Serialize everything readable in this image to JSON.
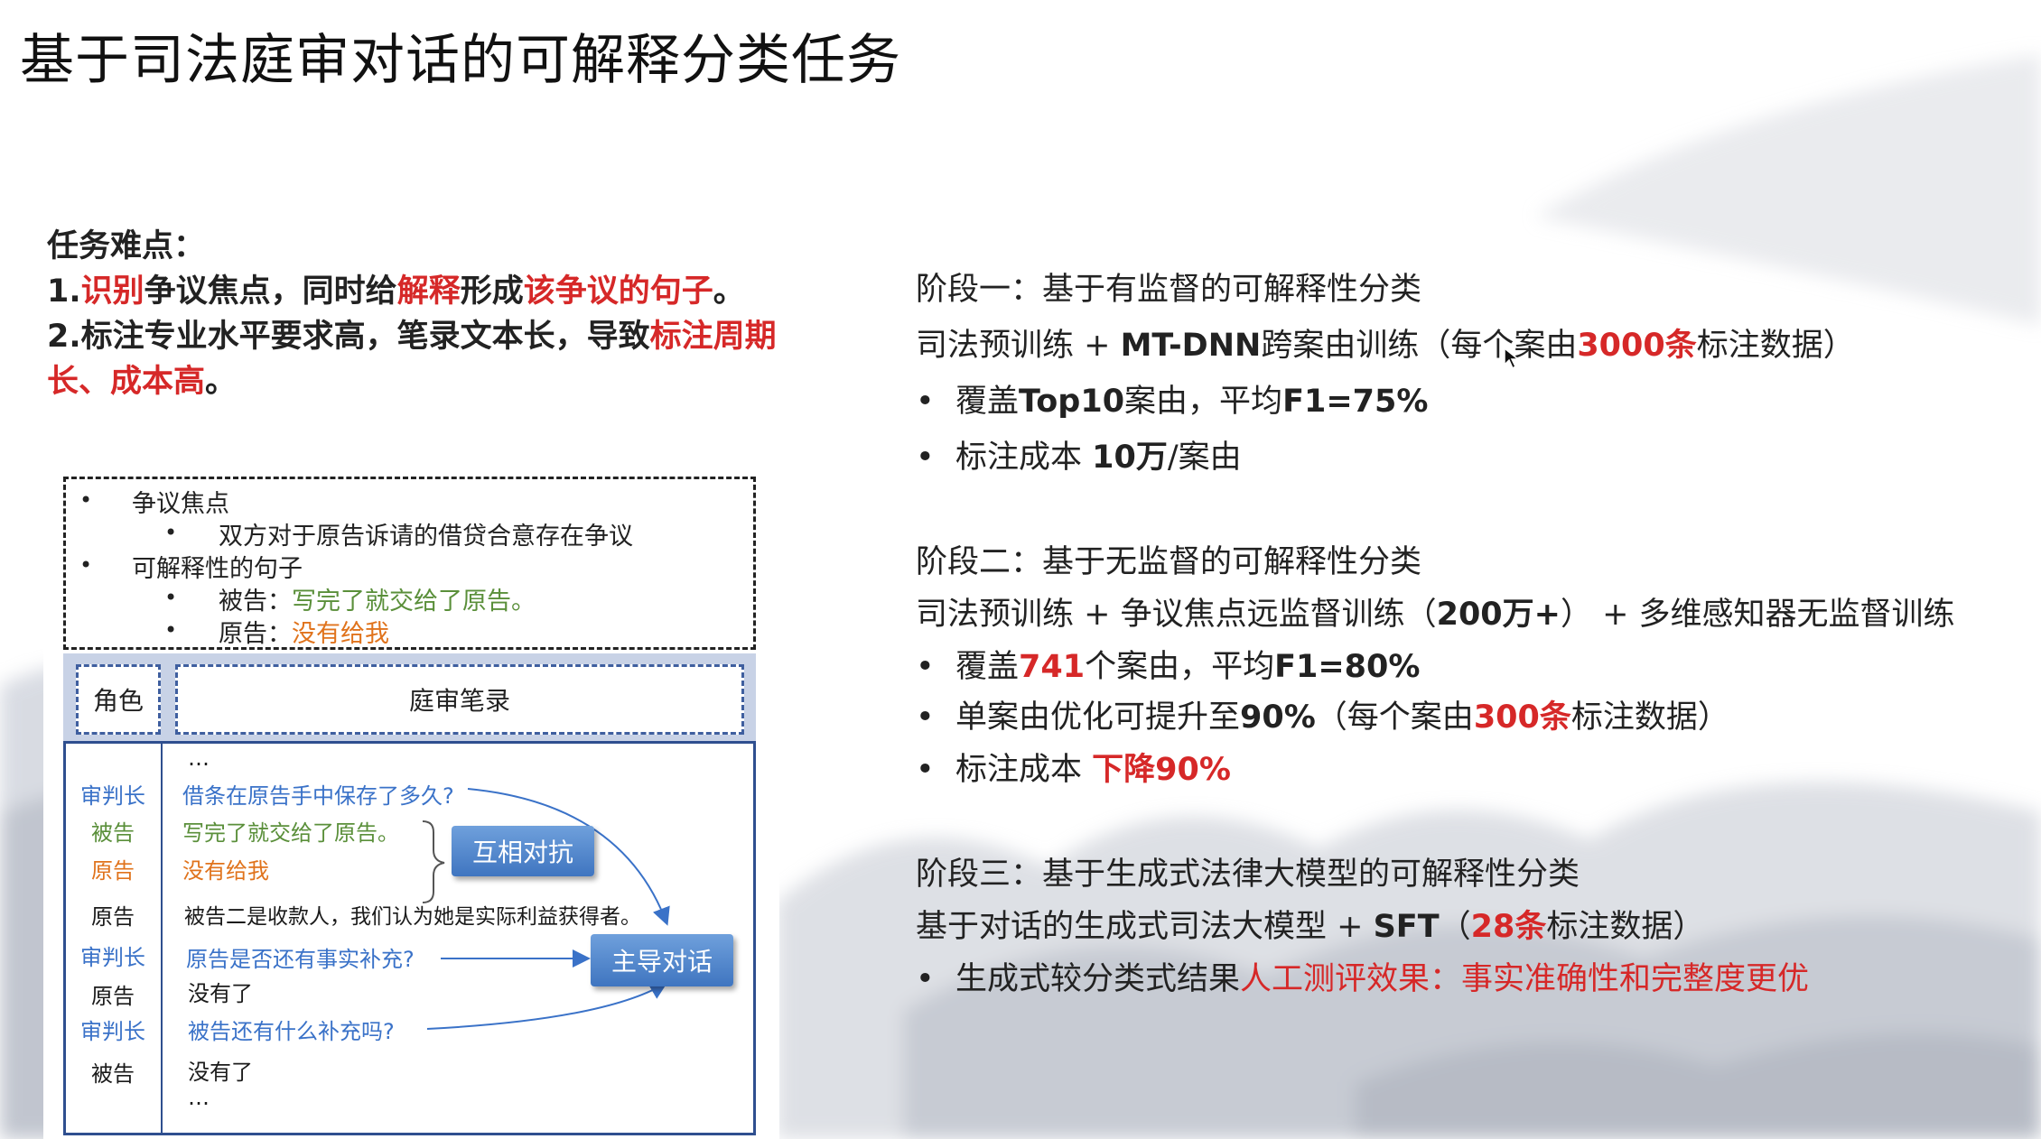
{
  "title": "基于司法庭审对话的可解释分类任务",
  "difficulty": {
    "heading": "任务难点：",
    "line1": {
      "p1": "1.",
      "p2": "识别",
      "p3": "争议焦点，同时给",
      "p4": "解释",
      "p5": "形成",
      "p6": "该争议的句子",
      "p7": "。"
    },
    "line2": {
      "p1": "2.标注专业水平要求高，笔录文本长，导致",
      "p2": "标注周期长、成本高",
      "p3": "。"
    }
  },
  "figure": {
    "bullets": {
      "focus_label": "争议焦点",
      "focus_detail": "双方对于原告诉请的借贷合意存在争议",
      "explain_label": "可解释性的句子",
      "defendant_prefix": "被告：",
      "defendant_text": "写完了就交给了原告。",
      "plaintiff_prefix": "原告：",
      "plaintiff_text": "没有给我"
    },
    "header": {
      "role": "角色",
      "record": "庭审笔录"
    },
    "ellipsis_top": "…",
    "ellipsis_bottom": "…",
    "rows": [
      {
        "role": "审判长",
        "text": "借条在原告手中保存了多久?"
      },
      {
        "role": "被告",
        "text": "写完了就交给了原告。"
      },
      {
        "role": "原告",
        "text": "没有给我"
      },
      {
        "role": "原告",
        "text": "被告二是收款人，我们认为她是实际利益获得者。"
      },
      {
        "role": "审判长",
        "text": "原告是否还有事实补充?"
      },
      {
        "role": "原告",
        "text": "没有了"
      },
      {
        "role": "审判长",
        "text": "被告还有什么补充吗?"
      },
      {
        "role": "被告",
        "text": "没有了"
      }
    ],
    "tag_confront": "互相对抗",
    "tag_lead": "主导对话"
  },
  "stages": [
    {
      "title": "阶段一：基于有监督的可解释性分类",
      "line": {
        "p1": "司法预训练 + ",
        "p2": "MT-DNN",
        "p3": "跨案由训练（每个案由",
        "p4": "3000条",
        "p5": "标注数据）"
      },
      "bullets": [
        {
          "p1": "覆盖",
          "p2": "Top10",
          "p3": "案由，平均",
          "p4": "F1=75%"
        },
        {
          "p1": "标注成本 ",
          "p2": "10万",
          "p3": "/案由"
        }
      ]
    },
    {
      "title": "阶段二：基于无监督的可解释性分类",
      "line": {
        "p1": "司法预训练 + 争议焦点远监督训练（",
        "p2": "200万+",
        "p3": "） + 多维感知器无监督训练"
      },
      "bullets": [
        {
          "p1": "覆盖",
          "p2": "741",
          "p3": "个案由，平均",
          "p4": "F1=80%"
        },
        {
          "p1": "单案由优化可提升至",
          "p2": "90%",
          "p3": "（每个案由",
          "p4": "300条",
          "p5": "标注数据）"
        },
        {
          "p1": "标注成本 ",
          "p2": "下降90%"
        }
      ]
    },
    {
      "title": "阶段三：基于生成式法律大模型的可解释性分类",
      "line": {
        "p1": "基于对话的生成式司法大模型 + ",
        "p2": "SFT",
        "p3": "（",
        "p4": "28条",
        "p5": "标注数据）"
      },
      "bullets": [
        {
          "p1": "生成式较分类式结果",
          "p2": "人工测评效果：事实准确性和完整度更优"
        }
      ]
    }
  ],
  "colors": {
    "accent_red": "#d62828",
    "figure_blue": "#3a72c8",
    "figure_orange": "#e0731c",
    "figure_green": "#5a8f3a",
    "tag_blue": "#4a80c8"
  }
}
